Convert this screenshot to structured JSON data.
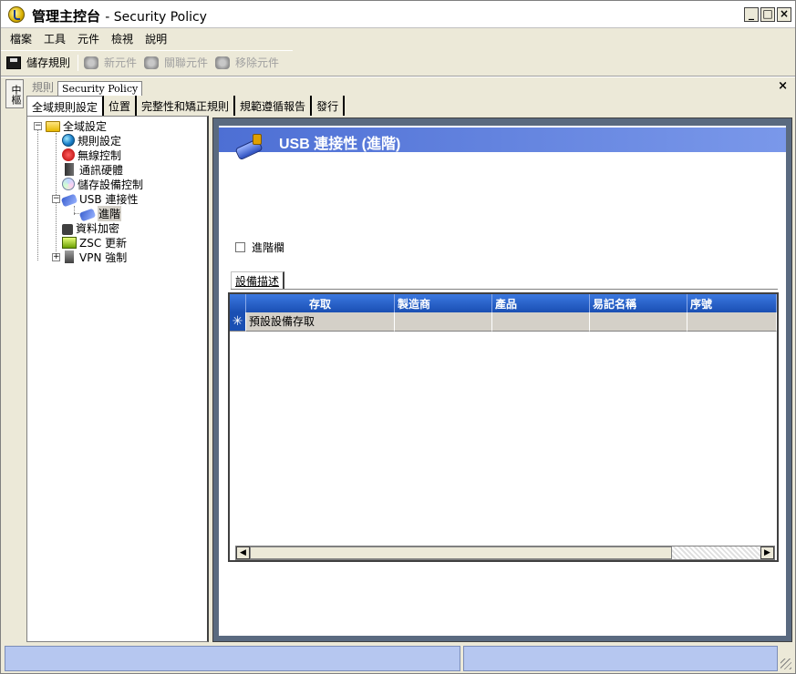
{
  "window": {
    "title_main": "管理主控台",
    "title_sub": "- Security Policy",
    "btn_minimize": "_",
    "btn_maximize": "□",
    "btn_close": "×"
  },
  "menu": [
    "檔案",
    "工具",
    "元件",
    "檢視",
    "說明"
  ],
  "toolbar": {
    "save": "儲存規則",
    "new_component": "新元件",
    "associate_component": "關聯元件",
    "remove_component": "移除元件"
  },
  "side_tab": "中樞",
  "doc_tabs": {
    "rules": "規則",
    "policy": "Security Policy",
    "close": "×"
  },
  "sub_tabs": [
    "全域規則設定",
    "位置",
    "完整性和矯正規則",
    "規範遵循報告",
    "發行"
  ],
  "tree": {
    "root": "全域設定",
    "items": [
      {
        "label": "規則設定",
        "icon": "globe-icon"
      },
      {
        "label": "無線控制",
        "icon": "wireless-icon"
      },
      {
        "label": "通訊硬體",
        "icon": "hardware-icon"
      },
      {
        "label": "儲存設備控制",
        "icon": "disc-icon"
      },
      {
        "label": "USB 連接性",
        "icon": "usb-icon"
      },
      {
        "label": "進階",
        "icon": "usb-icon"
      },
      {
        "label": "資料加密",
        "icon": "lock-icon"
      },
      {
        "label": "ZSC 更新",
        "icon": "zsc-icon"
      },
      {
        "label": "VPN 強制",
        "icon": "vpn-icon"
      }
    ]
  },
  "content": {
    "header_title": "USB 連接性 (進階)",
    "advanced_checkbox": "進階欄",
    "desc_tab": "設備描述",
    "columns": [
      "存取",
      "製造商",
      "產品",
      "易記名稱",
      "序號"
    ],
    "rows": [
      {
        "marker": "✳",
        "access": "預設設備存取",
        "manufacturer": "",
        "product": "",
        "friendly_name": "",
        "serial": ""
      }
    ]
  },
  "colors": {
    "header_band": "#4d6fd4",
    "grid_header": "#1a4fb3",
    "status_pane": "#b6c7f0"
  }
}
